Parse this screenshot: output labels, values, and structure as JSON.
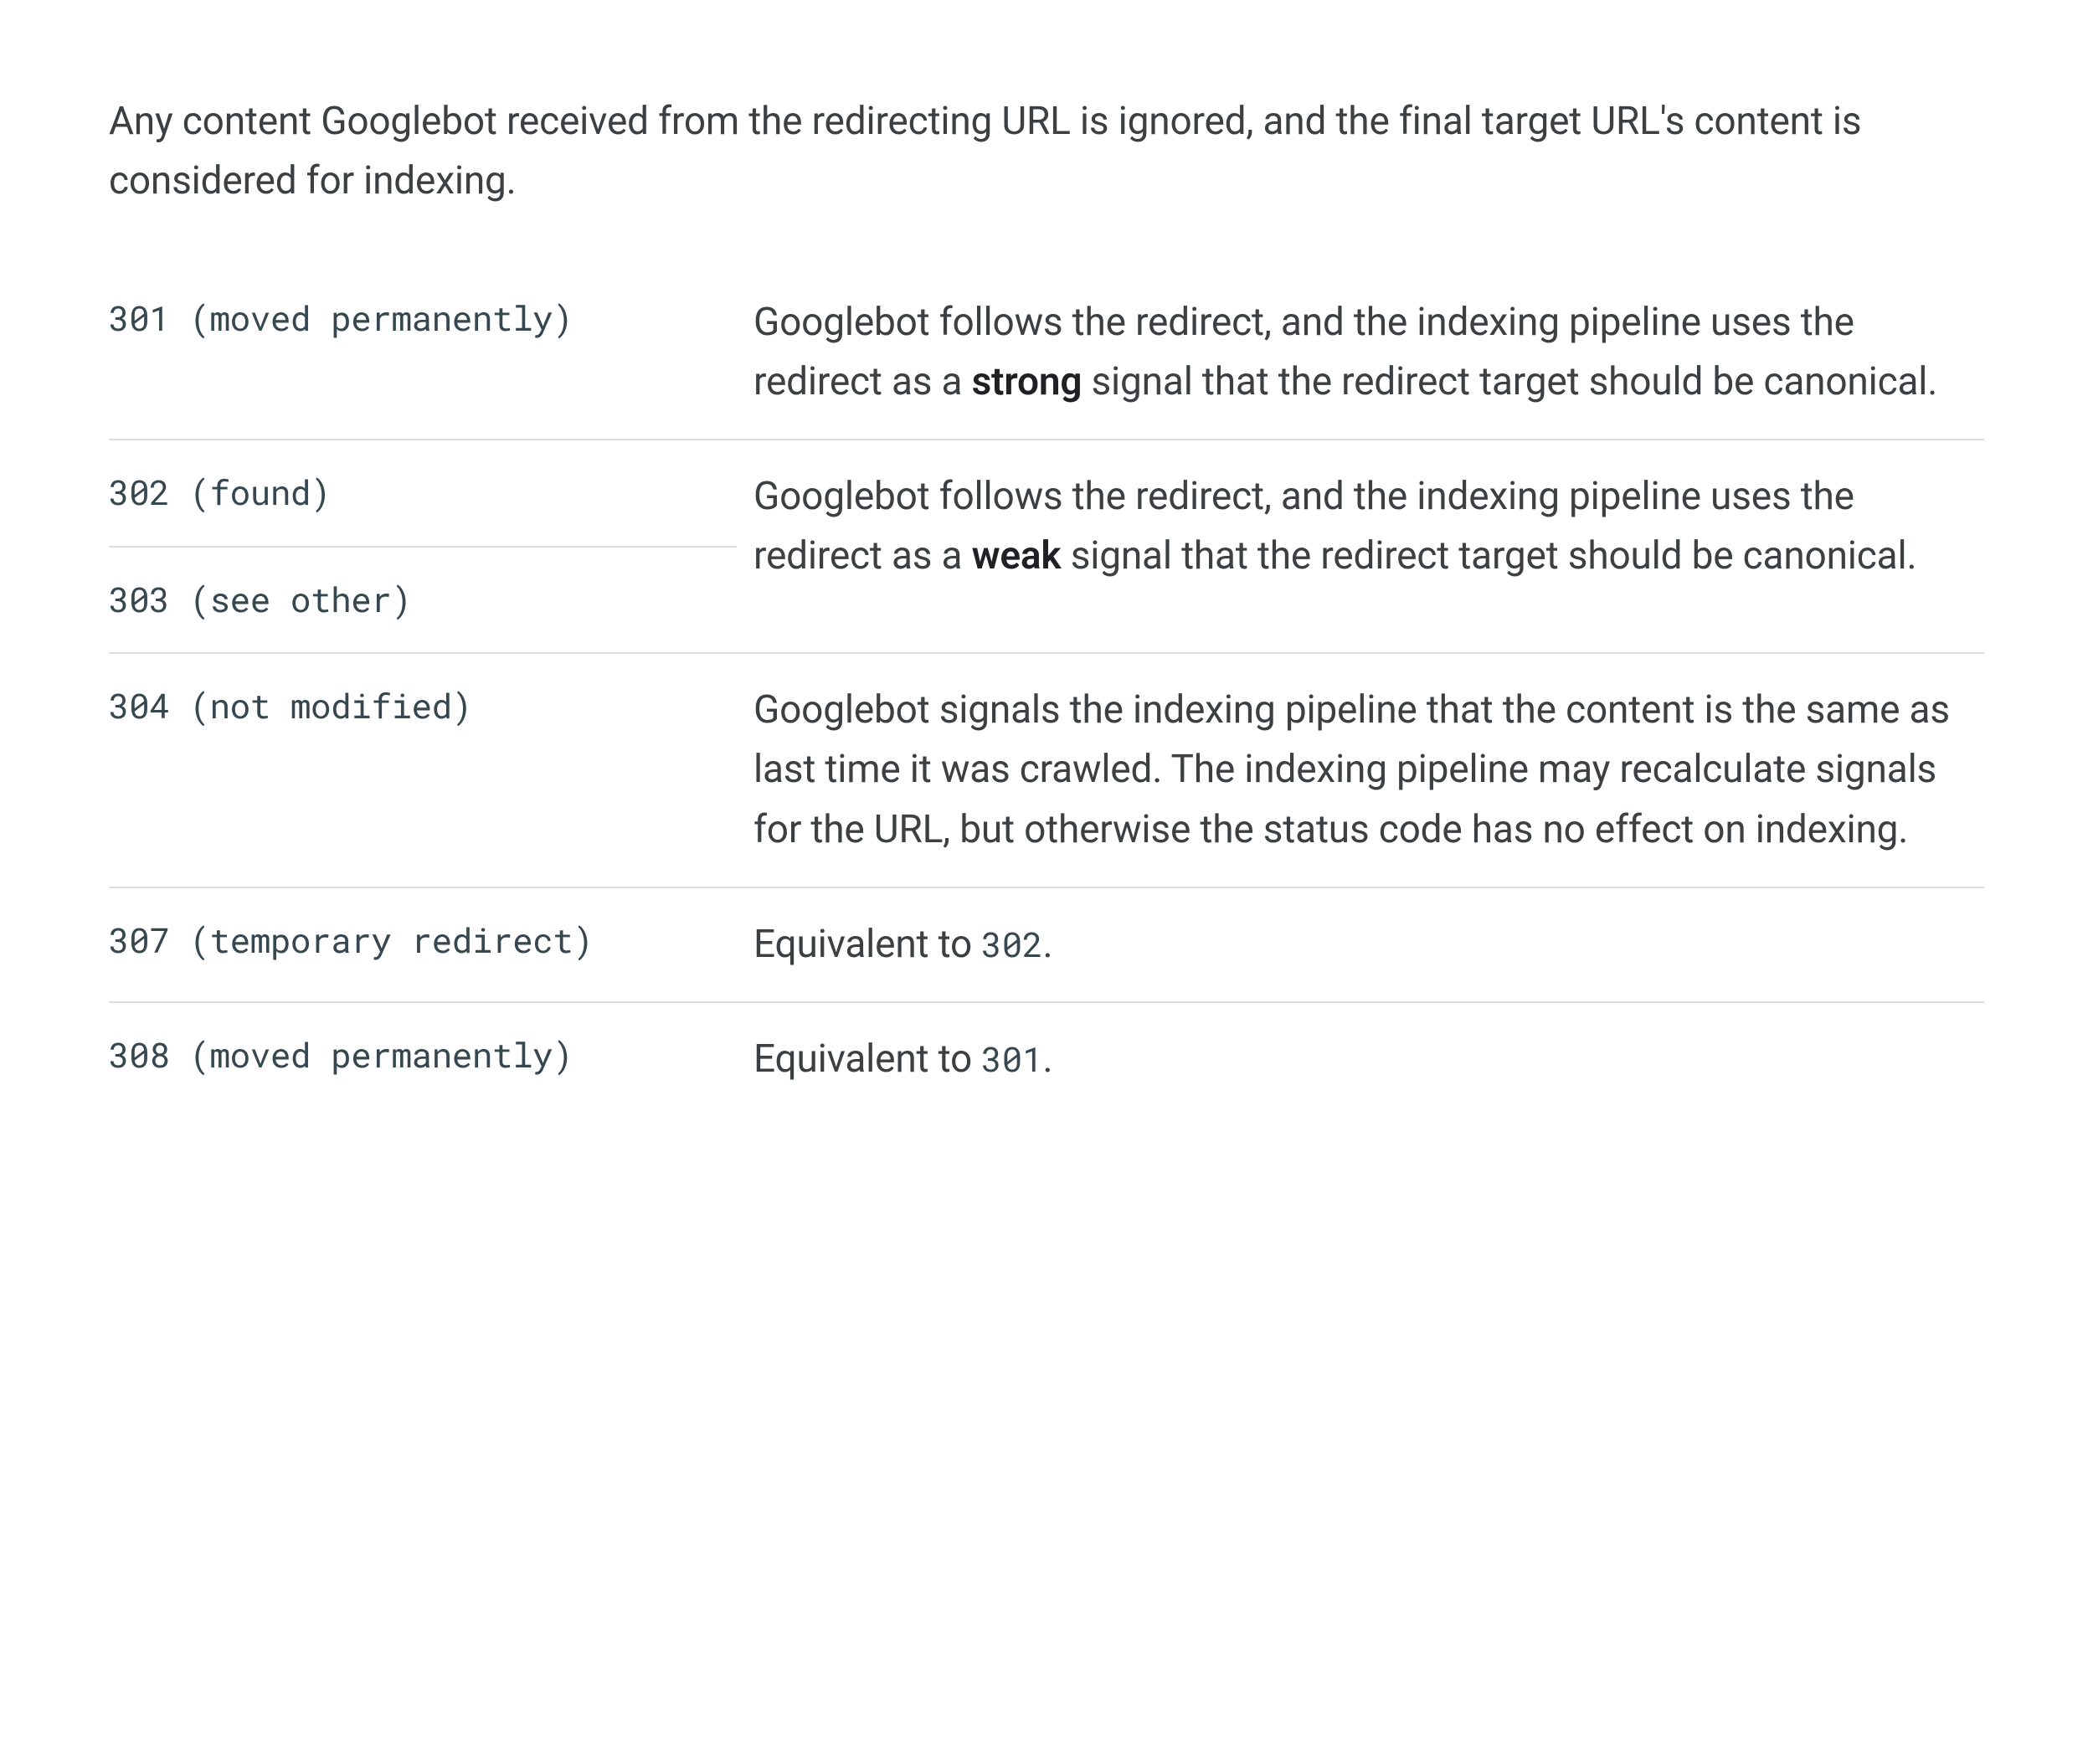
{
  "intro": "Any content Googlebot received from the redirecting URL is ignored, and the final target URL's content is considered for indexing.",
  "rows": {
    "r301": {
      "code": "301 (moved permanently)",
      "desc_pre": "Googlebot follows the redirect, and the indexing pipeline uses the redirect as a ",
      "strong": "strong",
      "desc_post": " signal that the redirect target should be canonical."
    },
    "r302": {
      "code": "302 (found)"
    },
    "r303": {
      "code": "303 (see other)"
    },
    "r302_303_desc": {
      "desc_pre": "Googlebot follows the redirect, and the indexing pipeline uses the redirect as a ",
      "strong": "weak",
      "desc_post": " signal that the redirect target should be canonical."
    },
    "r304": {
      "code": "304 (not modified)",
      "desc": "Googlebot signals the indexing pipeline that the content is the same as last time it was crawled. The indexing pipeline may recalculate signals for the URL, but otherwise the status code has no effect on indexing."
    },
    "r307": {
      "code": "307 (temporary redirect)",
      "desc_pre": "Equivalent to ",
      "code_inline": "302",
      "desc_post": "."
    },
    "r308": {
      "code": "308 (moved permanently)",
      "desc_pre": "Equivalent to ",
      "code_inline": "301",
      "desc_post": "."
    }
  }
}
